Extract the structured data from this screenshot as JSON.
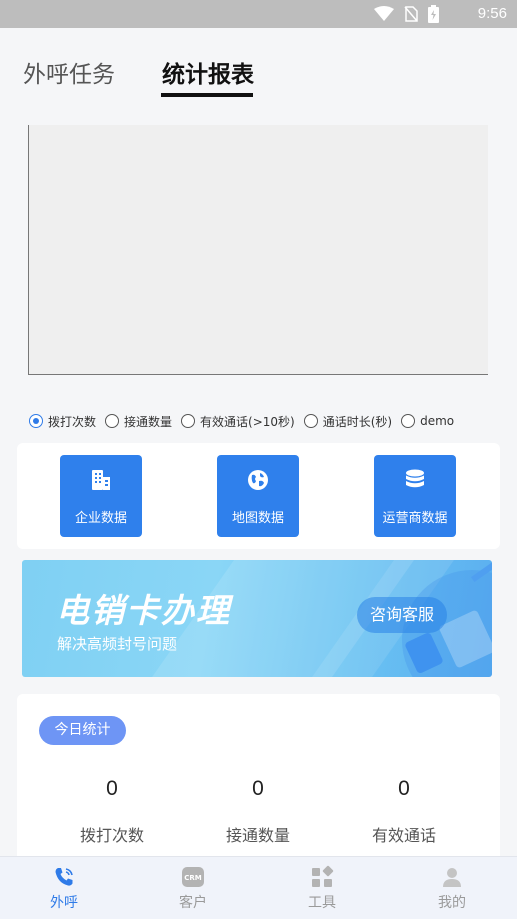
{
  "status_bar": {
    "time": "9:56"
  },
  "tabs": [
    {
      "label": "外呼任务",
      "active": false
    },
    {
      "label": "统计报表",
      "active": true
    }
  ],
  "metric_options": [
    {
      "label": "拨打次数",
      "checked": true
    },
    {
      "label": "接通数量",
      "checked": false
    },
    {
      "label": "有效通话(>10秒)",
      "checked": false
    },
    {
      "label": "通话时长(秒)",
      "checked": false
    },
    {
      "label": "demo",
      "checked": false
    }
  ],
  "data_buttons": [
    {
      "label": "企业数据",
      "icon": "building-icon"
    },
    {
      "label": "地图数据",
      "icon": "globe-icon"
    },
    {
      "label": "运营商数据",
      "icon": "database-icon"
    }
  ],
  "banner": {
    "title": "电销卡办理",
    "subtitle": "解决高频封号问题",
    "cta": "咨询客服"
  },
  "today_stats": {
    "badge": "今日统计",
    "items": [
      {
        "value": "0",
        "label": "拨打次数"
      },
      {
        "value": "0",
        "label": "接通数量"
      },
      {
        "value": "0",
        "label": "有效通话"
      }
    ]
  },
  "bottom_nav": [
    {
      "label": "外呼",
      "icon": "phone-icon",
      "active": true
    },
    {
      "label": "客户",
      "icon": "crm-icon",
      "active": false
    },
    {
      "label": "工具",
      "icon": "tools-icon",
      "active": false
    },
    {
      "label": "我的",
      "icon": "user-icon",
      "active": false
    }
  ],
  "colors": {
    "accent": "#2f80ec",
    "badge": "#6e95f5",
    "active_nav": "#2f7be8"
  }
}
